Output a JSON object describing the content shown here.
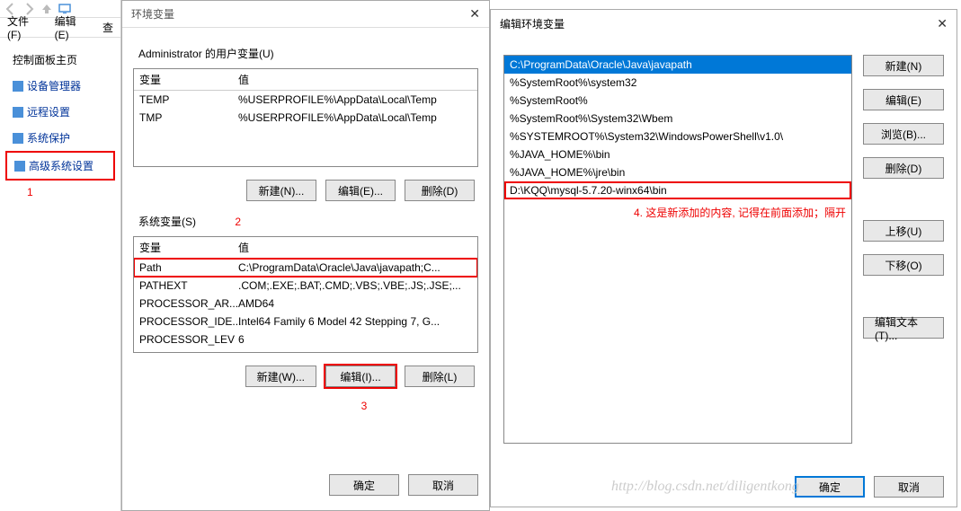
{
  "explorer": {
    "menu": {
      "file": "文件(F)",
      "edit": "编辑(E)",
      "view": "查"
    },
    "links": {
      "home": "控制面板主页",
      "device": "设备管理器",
      "remote": "远程设置",
      "protect": "系统保护",
      "advanced": "高级系统设置"
    },
    "num1": "1"
  },
  "env": {
    "title": "环境变量",
    "user_label": "Administrator 的用户变量(U)",
    "headers": {
      "var": "变量",
      "value": "值"
    },
    "user_vars": [
      {
        "name": "TEMP",
        "value": "%USERPROFILE%\\AppData\\Local\\Temp"
      },
      {
        "name": "TMP",
        "value": "%USERPROFILE%\\AppData\\Local\\Temp"
      }
    ],
    "user_btns": {
      "new": "新建(N)...",
      "edit": "编辑(E)...",
      "del": "删除(D)"
    },
    "sys_label": "系统变量(S)",
    "num2": "2",
    "sys_vars": [
      {
        "name": "Path",
        "value": "C:\\ProgramData\\Oracle\\Java\\javapath;C..."
      },
      {
        "name": "PATHEXT",
        "value": ".COM;.EXE;.BAT;.CMD;.VBS;.VBE;.JS;.JSE;..."
      },
      {
        "name": "PROCESSOR_AR...",
        "value": "AMD64"
      },
      {
        "name": "PROCESSOR_IDE...",
        "value": "Intel64 Family 6 Model 42 Stepping 7, G..."
      },
      {
        "name": "PROCESSOR_LEV",
        "value": "6"
      }
    ],
    "sys_btns": {
      "new": "新建(W)...",
      "edit": "编辑(I)...",
      "del": "删除(L)"
    },
    "num3": "3",
    "footer": {
      "ok": "确定",
      "cancel": "取消"
    }
  },
  "edit": {
    "title": "编辑环境变量",
    "paths": [
      "C:\\ProgramData\\Oracle\\Java\\javapath",
      "%SystemRoot%\\system32",
      "%SystemRoot%",
      "%SystemRoot%\\System32\\Wbem",
      "%SYSTEMROOT%\\System32\\WindowsPowerShell\\v1.0\\",
      "%JAVA_HOME%\\bin",
      "%JAVA_HOME%\\jre\\bin",
      "D:\\KQQ\\mysql-5.7.20-winx64\\bin"
    ],
    "annotation": "4. 这是新添加的内容, 记得在前面添加；隔开",
    "btns": {
      "new": "新建(N)",
      "edit": "编辑(E)",
      "browse": "浏览(B)...",
      "del": "删除(D)",
      "up": "上移(U)",
      "down": "下移(O)",
      "edit_text": "编辑文本(T)..."
    },
    "footer": {
      "ok": "确定",
      "cancel": "取消"
    }
  },
  "watermark": "http://blog.csdn.net/diligentkong"
}
